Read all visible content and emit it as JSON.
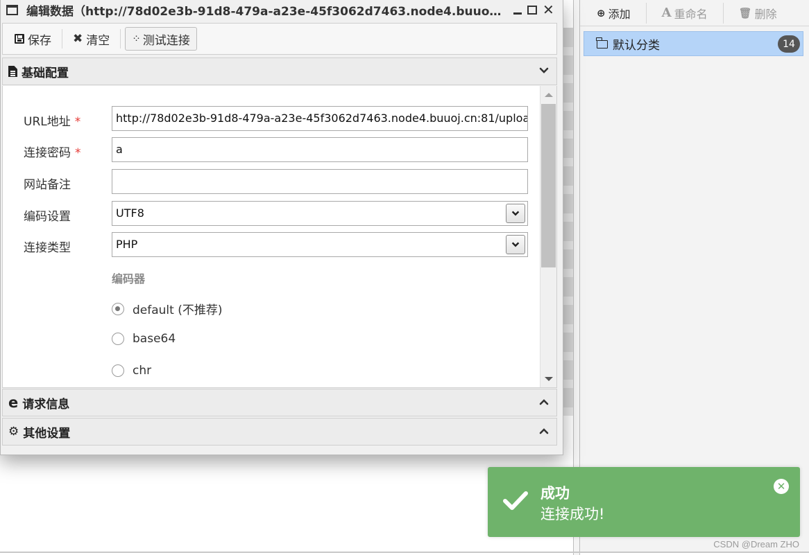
{
  "dialog": {
    "title": "编辑数据（http://78d02e3b-91d8-479a-a23e-45f3062d7463.node4.buuoj...",
    "toolbar": {
      "save_label": "保存",
      "clear_label": "清空",
      "test_label": "测试连接"
    },
    "sections": {
      "basic": "基础配置",
      "request": "请求信息",
      "other": "其他设置"
    },
    "fields": {
      "url": {
        "label": "URL地址",
        "required_mark": "*",
        "value": "http://78d02e3b-91d8-479a-a23e-45f3062d7463.node4.buuoj.cn:81/uploa"
      },
      "password": {
        "label": "连接密码",
        "required_mark": "*",
        "value": "a"
      },
      "note": {
        "label": "网站备注",
        "value": ""
      },
      "encoding": {
        "label": "编码设置",
        "value": "UTF8"
      },
      "type": {
        "label": "连接类型",
        "value": "PHP"
      }
    },
    "encoder": {
      "title": "编码器",
      "options": [
        "default (不推荐)",
        "base64",
        "chr"
      ],
      "selected": "default (不推荐)"
    }
  },
  "right_panel": {
    "toolbar": {
      "add": "添加",
      "rename": "重命名",
      "delete": "删除"
    },
    "category": {
      "name": "默认分类",
      "count": "14"
    }
  },
  "toast": {
    "title": "成功",
    "message": "连接成功!",
    "color": "#6fb36b"
  },
  "watermark": "CSDN @Dream ZHO"
}
